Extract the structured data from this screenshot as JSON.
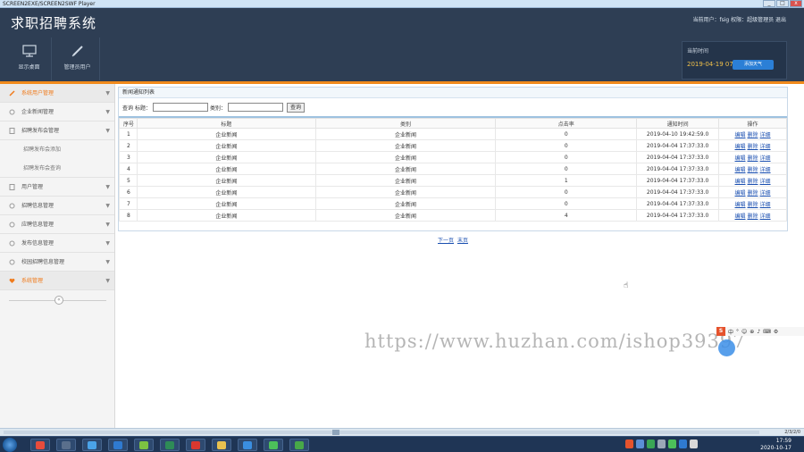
{
  "window": {
    "title": "SCREEN2EXE/SCREEN2SWF Player",
    "buttons": [
      "_",
      "□",
      "x"
    ]
  },
  "header": {
    "app_title": "求职招聘系统",
    "user_info": "当前用户：fsig  权限：超级管理员  退出",
    "nav": [
      {
        "label": "显示桌面",
        "icon": "monitor-icon"
      },
      {
        "label": "管理员用户",
        "icon": "pencil-icon"
      }
    ],
    "time_label": "当前时间",
    "time_value": "2019-04-19 07",
    "weather_button": "添加天气"
  },
  "sidebar": {
    "items": [
      {
        "label": "系统用户管理",
        "icon": "pencil-icon",
        "active": true
      },
      {
        "label": "企业新闻管理",
        "icon": "settings-icon"
      },
      {
        "label": "招聘发布会管理",
        "icon": "doc-icon"
      },
      {
        "label": "招聘发布会添加",
        "sub": true
      },
      {
        "label": "招聘发布会查询",
        "sub": true
      },
      {
        "label": "用户管理",
        "icon": "doc-icon"
      },
      {
        "label": "招聘信息管理",
        "icon": "settings-icon"
      },
      {
        "label": "应聘信息管理",
        "icon": "settings-icon"
      },
      {
        "label": "发布信息管理",
        "icon": "settings-icon"
      },
      {
        "label": "校园招聘信息管理",
        "icon": "settings-icon"
      },
      {
        "label": "系统管理",
        "icon": "heart-icon",
        "active": true
      }
    ],
    "collapse_symbol": "«"
  },
  "panel": {
    "title": "新闻通知列表",
    "search": {
      "query_label": "查询",
      "title_label": "标题：",
      "type_label": "类别：",
      "button": "查询"
    },
    "columns": [
      "序号",
      "标题",
      "类别",
      "点击率",
      "通知时间",
      "操作"
    ],
    "rows": [
      [
        "1",
        "企业新闻",
        "企业新闻",
        "0",
        "2019-04-10 19:42:59.0"
      ],
      [
        "2",
        "企业新闻",
        "企业新闻",
        "0",
        "2019-04-04 17:37:33.0"
      ],
      [
        "3",
        "企业新闻",
        "企业新闻",
        "0",
        "2019-04-04 17:37:33.0"
      ],
      [
        "4",
        "企业新闻",
        "企业新闻",
        "0",
        "2019-04-04 17:37:33.0"
      ],
      [
        "5",
        "企业新闻",
        "企业新闻",
        "1",
        "2019-04-04 17:37:33.0"
      ],
      [
        "6",
        "企业新闻",
        "企业新闻",
        "0",
        "2019-04-04 17:37:33.0"
      ],
      [
        "7",
        "企业新闻",
        "企业新闻",
        "0",
        "2019-04-04 17:37:33.0"
      ],
      [
        "8",
        "企业新闻",
        "企业新闻",
        "4",
        "2019-04-04 17:37:33.0"
      ]
    ],
    "ops": [
      "编辑",
      "删除",
      "详细"
    ],
    "pager": [
      "下一页",
      "末页"
    ]
  },
  "watermark": "https://www.huzhan.com/ishop39397",
  "ime": {
    "logo": "S",
    "items": [
      "中",
      "°",
      "☺",
      "⊕",
      "♪",
      "⌨",
      "⚙"
    ]
  },
  "player": {
    "counter": "2/3/2/0"
  },
  "taskbar": {
    "time": "17:59",
    "date": "2020-10-17",
    "apps": [
      "chrome",
      "media",
      "browser",
      "qq-browser",
      "leaf",
      "excel",
      "flash",
      "folder",
      "qq",
      "wechat",
      "player"
    ]
  },
  "colors": {
    "header_bg": "#2e3e54",
    "accent": "#f08a1c",
    "link": "#1a4fb0"
  }
}
